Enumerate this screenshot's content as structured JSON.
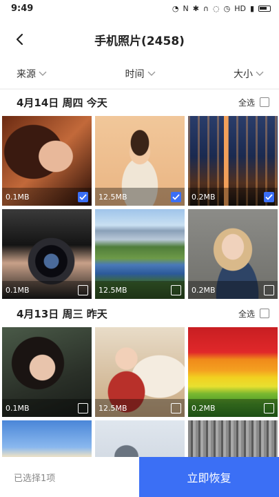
{
  "status_bar": {
    "time": "9:49",
    "icons": [
      "alarm-icon",
      "nfc-icon",
      "bluetooth-icon",
      "headset-icon",
      "vibrate-icon",
      "clock-icon",
      "hd-icon",
      "signal-icon",
      "battery-icon"
    ],
    "hd_label": "HD"
  },
  "header": {
    "title": "手机照片(2458)"
  },
  "filters": [
    {
      "label": "来源"
    },
    {
      "label": "时间"
    },
    {
      "label": "大小"
    }
  ],
  "sections": [
    {
      "date": "4月14日 周四 今天",
      "select_all": "全选",
      "photos": [
        {
          "size": "0.1MB",
          "checked": true
        },
        {
          "size": "12.5MB",
          "checked": true
        },
        {
          "size": "0.2MB",
          "checked": true
        },
        {
          "size": "0.1MB",
          "checked": false
        },
        {
          "size": "12.5MB",
          "checked": false
        },
        {
          "size": "0.2MB",
          "checked": false
        }
      ]
    },
    {
      "date": "4月13日 周三 昨天",
      "select_all": "全选",
      "photos": [
        {
          "size": "0.1MB",
          "checked": false
        },
        {
          "size": "12.5MB",
          "checked": false
        },
        {
          "size": "0.2MB",
          "checked": false
        }
      ]
    }
  ],
  "bottom_bar": {
    "selected_text": "已选择1项",
    "restore_label": "立即恢复"
  },
  "colors": {
    "accent": "#3b6ff5"
  }
}
